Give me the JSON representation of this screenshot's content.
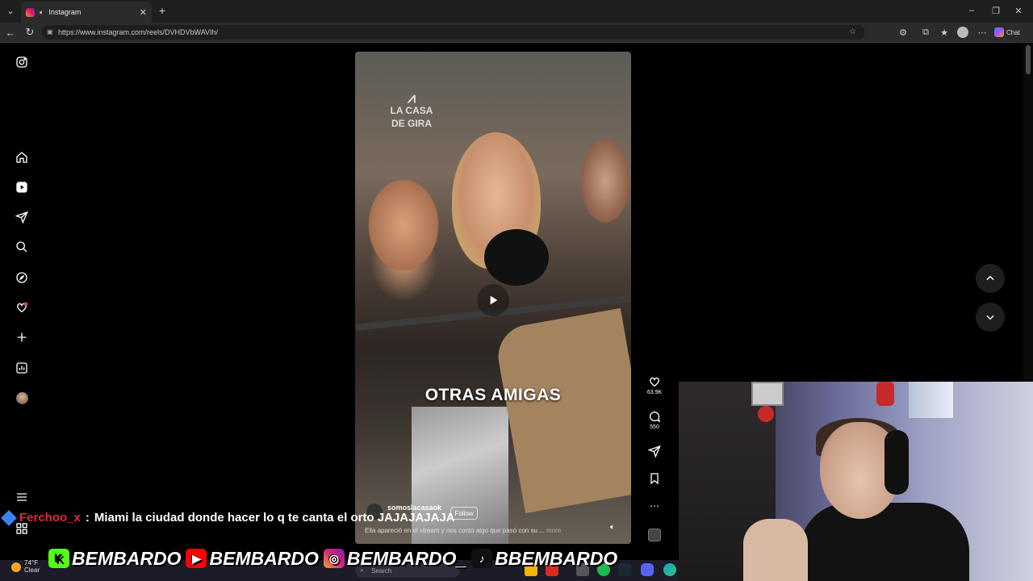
{
  "browser": {
    "tab_title": "Instagram",
    "url": "https://www.instagram.com/reels/DVHDVbWAVIh/",
    "chat_label": "Chat"
  },
  "sidebar": {
    "items": [
      "instagram-logo",
      "home",
      "reels",
      "messages",
      "search",
      "explore",
      "notifications",
      "create",
      "dashboard",
      "profile",
      "more",
      "also-from-meta"
    ]
  },
  "reel": {
    "brand_line1": "LA CASA",
    "brand_line2": "DE GIRA",
    "caption_overlay": "OTRAS AMIGAS",
    "author": "somoslacasaok",
    "follow_label": "Follow",
    "description": "Ella apareció en el stream y nos contó algo que pasó con su ...",
    "more_label": "more",
    "likes": "63.9K",
    "comments": "550"
  },
  "stream_overlay": {
    "chat_user": "Ferchoo_x",
    "chat_separator": ":",
    "chat_message": "Miami la ciudad donde hacer lo q te canta el orto JAJAJAJAJA",
    "socials": [
      {
        "platform": "kick",
        "handle": "BEMBARDO",
        "color": "#53fc18",
        "glyph": "K"
      },
      {
        "platform": "youtube",
        "handle": "BEMBARDO",
        "color": "#ff0000",
        "glyph": "▶"
      },
      {
        "platform": "instagram",
        "handle": "BEMBARDO_",
        "color": "#d62976",
        "glyph": "◎"
      },
      {
        "platform": "tiktok",
        "handle": "BBEMBARDO",
        "color": "#111111",
        "glyph": "♪"
      }
    ]
  },
  "taskbar": {
    "temperature": "74°F",
    "condition": "Clear",
    "search_placeholder": "Search"
  },
  "colors": {
    "accent_red": "#e0283c",
    "instagram_gradient": [
      "#f9a825",
      "#e91e63",
      "#7b1fa2"
    ]
  }
}
